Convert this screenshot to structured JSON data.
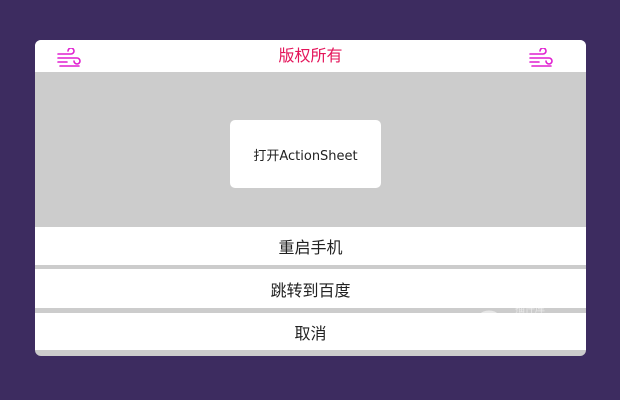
{
  "header": {
    "title": "版权所有",
    "left_icon": "wind-icon",
    "right_icon": "wind-icon",
    "accent_color": "#e4145a",
    "icon_color": "#e01fd0"
  },
  "main": {
    "open_button_label": "打开ActionSheet"
  },
  "action_sheet": {
    "items": [
      {
        "label": "重启手机"
      },
      {
        "label": "跳转到百度"
      },
      {
        "label": "取消"
      }
    ]
  },
  "watermark": {
    "text": "jQuery",
    "subtext": "插件库"
  },
  "colors": {
    "background": "#3d2c60",
    "panel": "#cccccc",
    "surface": "#ffffff"
  }
}
